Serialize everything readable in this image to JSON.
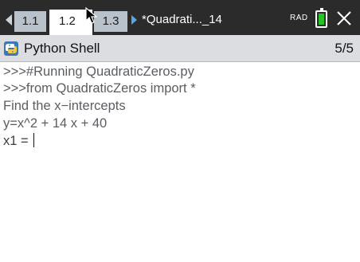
{
  "tabs": [
    {
      "label": "1.1",
      "active": false
    },
    {
      "label": "1.2",
      "active": true
    },
    {
      "label": "1.3",
      "active": false
    }
  ],
  "document": {
    "title": "*Quadrati..._14"
  },
  "status": {
    "angle_mode": "RAD",
    "battery_color": "#27c226"
  },
  "app": {
    "title": "Python Shell",
    "page_counter": "5/5"
  },
  "shell": {
    "lines": [
      ">>>#Running QuadraticZeros.py",
      ">>>from QuadraticZeros import *",
      "Find the x−intercepts",
      "y=x^2 + 14 x + 40"
    ],
    "input_prompt": "x1 = ",
    "input_value": ""
  },
  "icons": {
    "prev": "left-arrow-icon",
    "next": "right-arrow-icon",
    "pointer": "mouse-pointer-icon",
    "battery": "battery-icon",
    "close": "close-icon",
    "python": "python-logo-icon"
  },
  "colors": {
    "titlebar": "#2b2b2b",
    "inactive_tab": "#b9c1ca",
    "next_arrow": "#5aa5e6"
  }
}
